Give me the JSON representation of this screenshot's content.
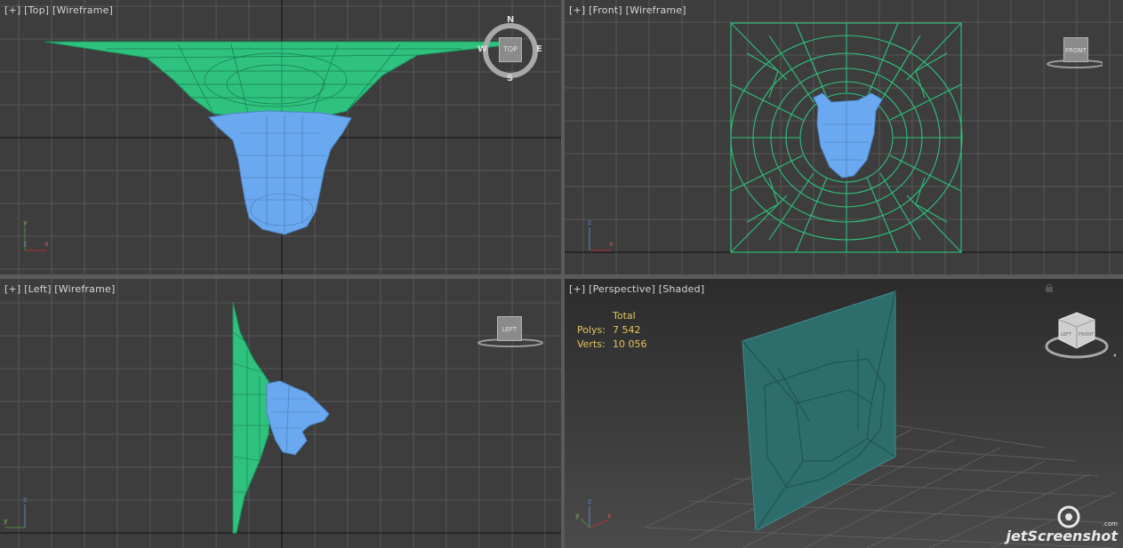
{
  "viewports": {
    "top": {
      "plus": "[+]",
      "view": "[Top]",
      "mode": "[Wireframe]",
      "cube_label": "TOP",
      "compass": {
        "n": "N",
        "s": "S",
        "e": "E",
        "w": "W"
      },
      "axes": {
        "a": "y",
        "b": "x",
        "c": "z"
      }
    },
    "front": {
      "plus": "[+]",
      "view": "[Front]",
      "mode": "[Wireframe]",
      "cube_label": "FRONT",
      "axes": {
        "a": "z",
        "b": "x"
      }
    },
    "left": {
      "plus": "[+]",
      "view": "[Left]",
      "mode": "[Wireframe]",
      "cube_label": "LEFT",
      "axes": {
        "a": "z",
        "b": "y"
      }
    },
    "perspective": {
      "plus": "[+]",
      "view": "[Perspective]",
      "mode": "[Shaded]",
      "cube_labels": {
        "front": "FRONT",
        "left": "LEFT"
      },
      "axes": {
        "a": "z",
        "b": "y",
        "c": "x"
      }
    }
  },
  "stats": {
    "header": "Total",
    "polys_label": "Polys:",
    "polys_value": "7 542",
    "verts_label": "Verts:",
    "verts_value": "10 056"
  },
  "watermark": {
    "brand": "jetScreenshot",
    "suffix": ".com"
  },
  "colors": {
    "viewport_bg": "#3d3d3d",
    "grid": "#575757",
    "grid_axis": "#111111",
    "mesh_green": "#2ec27e",
    "mesh_blue": "#6aa8ef",
    "active_border": "#c6a23e",
    "stat_text": "#e6c35e",
    "shaded_panel": "#2d6d6b"
  }
}
